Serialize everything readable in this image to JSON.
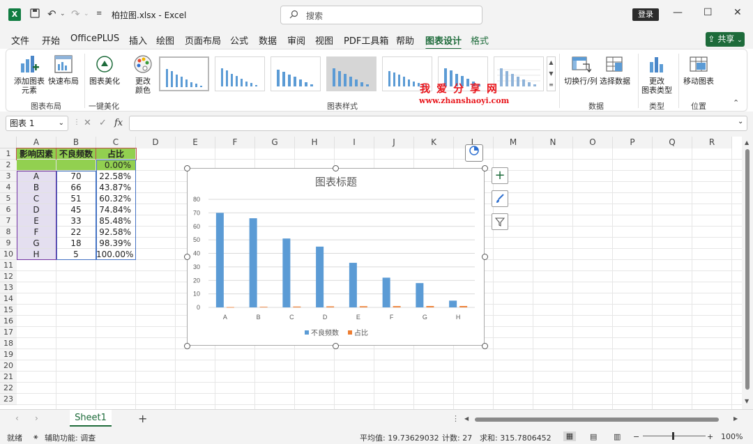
{
  "titlebar": {
    "doc_title": "柏拉图.xlsx  -  Excel",
    "search_placeholder": "搜索",
    "login": "登录"
  },
  "menu": {
    "tabs": [
      "文件",
      "开始",
      "OfficePLUS",
      "插入",
      "绘图",
      "页面布局",
      "公式",
      "数据",
      "审阅",
      "视图",
      "PDF工具箱",
      "帮助",
      "图表设计",
      "格式"
    ],
    "active": "图表设计",
    "share": "共享"
  },
  "ribbon": {
    "add_element": "添加图表\n元素",
    "quick_layout": "快速布局",
    "beautify": "图表美化",
    "change_color": "更改\n颜色",
    "switch_row_col": "切换行/列",
    "select_data": "选择数据",
    "change_type": "更改\n图表类型",
    "move_chart": "移动图表",
    "groups": {
      "layout": "图表布局",
      "onekey": "一键美化",
      "styles": "图表样式",
      "data": "数据",
      "type": "类型",
      "location": "位置"
    },
    "watermark_cn": "我爱分享网",
    "watermark_url": "www.zhanshaoyi.com"
  },
  "formula_bar": {
    "namebox": "图表 1",
    "fx": "fx",
    "value": ""
  },
  "sheet": {
    "columns": [
      "A",
      "B",
      "C",
      "D",
      "E",
      "F",
      "G",
      "H",
      "I",
      "J",
      "K",
      "L",
      "M",
      "N",
      "O",
      "P",
      "Q",
      "R"
    ],
    "rows": [
      "1",
      "2",
      "3",
      "4",
      "5",
      "6",
      "7",
      "8",
      "9",
      "10",
      "11",
      "12",
      "13",
      "14",
      "15",
      "16",
      "17",
      "18",
      "19",
      "20",
      "21",
      "22",
      "23"
    ],
    "headers": [
      "影响因素",
      "不良频数",
      "占比"
    ],
    "row2": [
      "",
      "",
      "0.00%"
    ],
    "data": [
      [
        "A",
        "70",
        "22.58%"
      ],
      [
        "B",
        "66",
        "43.87%"
      ],
      [
        "C",
        "51",
        "60.32%"
      ],
      [
        "D",
        "45",
        "74.84%"
      ],
      [
        "E",
        "33",
        "85.48%"
      ],
      [
        "F",
        "22",
        "92.58%"
      ],
      [
        "G",
        "18",
        "98.39%"
      ],
      [
        "H",
        "5",
        "100.00%"
      ]
    ]
  },
  "chart_data": {
    "type": "bar",
    "title": "图表标题",
    "categories": [
      "A",
      "B",
      "C",
      "D",
      "E",
      "F",
      "G",
      "H"
    ],
    "series": [
      {
        "name": "不良频数",
        "values": [
          70,
          66,
          51,
          45,
          33,
          22,
          18,
          5
        ],
        "color": "#5b9bd5"
      },
      {
        "name": "占比",
        "values": [
          0.2258,
          0.4387,
          0.6032,
          0.7484,
          0.8548,
          0.9258,
          0.9839,
          1.0
        ],
        "color": "#ed7d31"
      }
    ],
    "ylim": [
      0,
      80
    ],
    "yticks": [
      0,
      10,
      20,
      30,
      40,
      50,
      60,
      70,
      80
    ],
    "grid": true,
    "legend": "bottom"
  },
  "sheet_tabs": {
    "active": "Sheet1",
    "add": "+"
  },
  "status": {
    "ready": "就绪",
    "accessibility": "辅助功能: 调查",
    "average": "平均值: 19.73629032",
    "count": "计数: 27",
    "sum": "求和: 315.7806452",
    "zoom": "100%"
  },
  "colors": {
    "accent": "#1d6b3a",
    "header_fill_green": "#92d050",
    "header_fill_red": "#c0504d",
    "data_fill": "#e4dff0",
    "range_blue": "#4472c4"
  }
}
